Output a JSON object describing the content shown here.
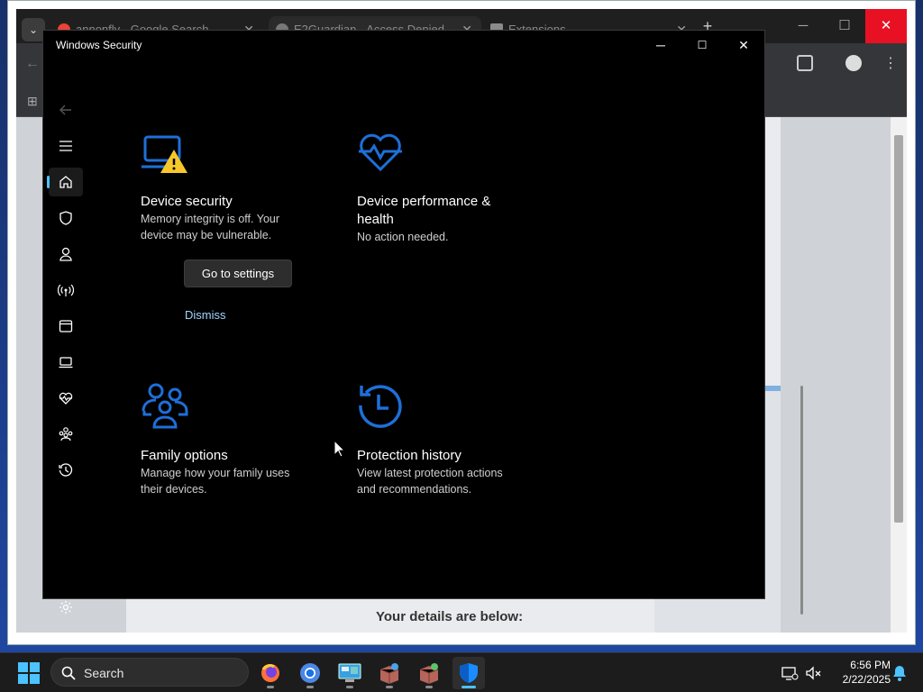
{
  "browser": {
    "tabs": [
      {
        "title": "annonfly - Google Search"
      },
      {
        "title": "E2Guardian - Access Denied"
      },
      {
        "title": "Extensions"
      }
    ],
    "page_text": "Your details are below:"
  },
  "window": {
    "title": "Windows Security"
  },
  "nav": {
    "items": [
      "back",
      "menu",
      "home",
      "virus-threat-protection",
      "account-protection",
      "firewall-network",
      "app-browser-control",
      "device-security",
      "device-performance",
      "family-options",
      "protection-history",
      "settings"
    ],
    "active": "home"
  },
  "tiles": {
    "device_security": {
      "title": "Device security",
      "desc_line1": "Memory integrity is off. Your",
      "desc_line2": "device may be vulnerable.",
      "button": "Go to settings",
      "link": "Dismiss",
      "icon": "laptop-warning-icon"
    },
    "device_performance": {
      "title_line1": "Device performance &",
      "title_line2": "health",
      "desc": "No action needed.",
      "icon": "heart-pulse-icon"
    },
    "family_options": {
      "title": "Family options",
      "desc_line1": "Manage how your family uses",
      "desc_line2": "their devices.",
      "icon": "family-icon"
    },
    "protection_history": {
      "title": "Protection history",
      "desc_line1": "View latest protection actions",
      "desc_line2": "and recommendations.",
      "icon": "history-icon"
    }
  },
  "taskbar": {
    "search_label": "Search",
    "apps": [
      "firefox",
      "chrome",
      "control-panel",
      "app-box-1",
      "app-box-2",
      "windows-security"
    ],
    "active_app": "windows-security",
    "time": "6:56 PM",
    "date": "2/22/2025"
  },
  "colors": {
    "accent_blue": "#1e6fd9",
    "warning_yellow": "#f8c82a",
    "link": "#9fd6ff",
    "close_red": "#e81123"
  }
}
